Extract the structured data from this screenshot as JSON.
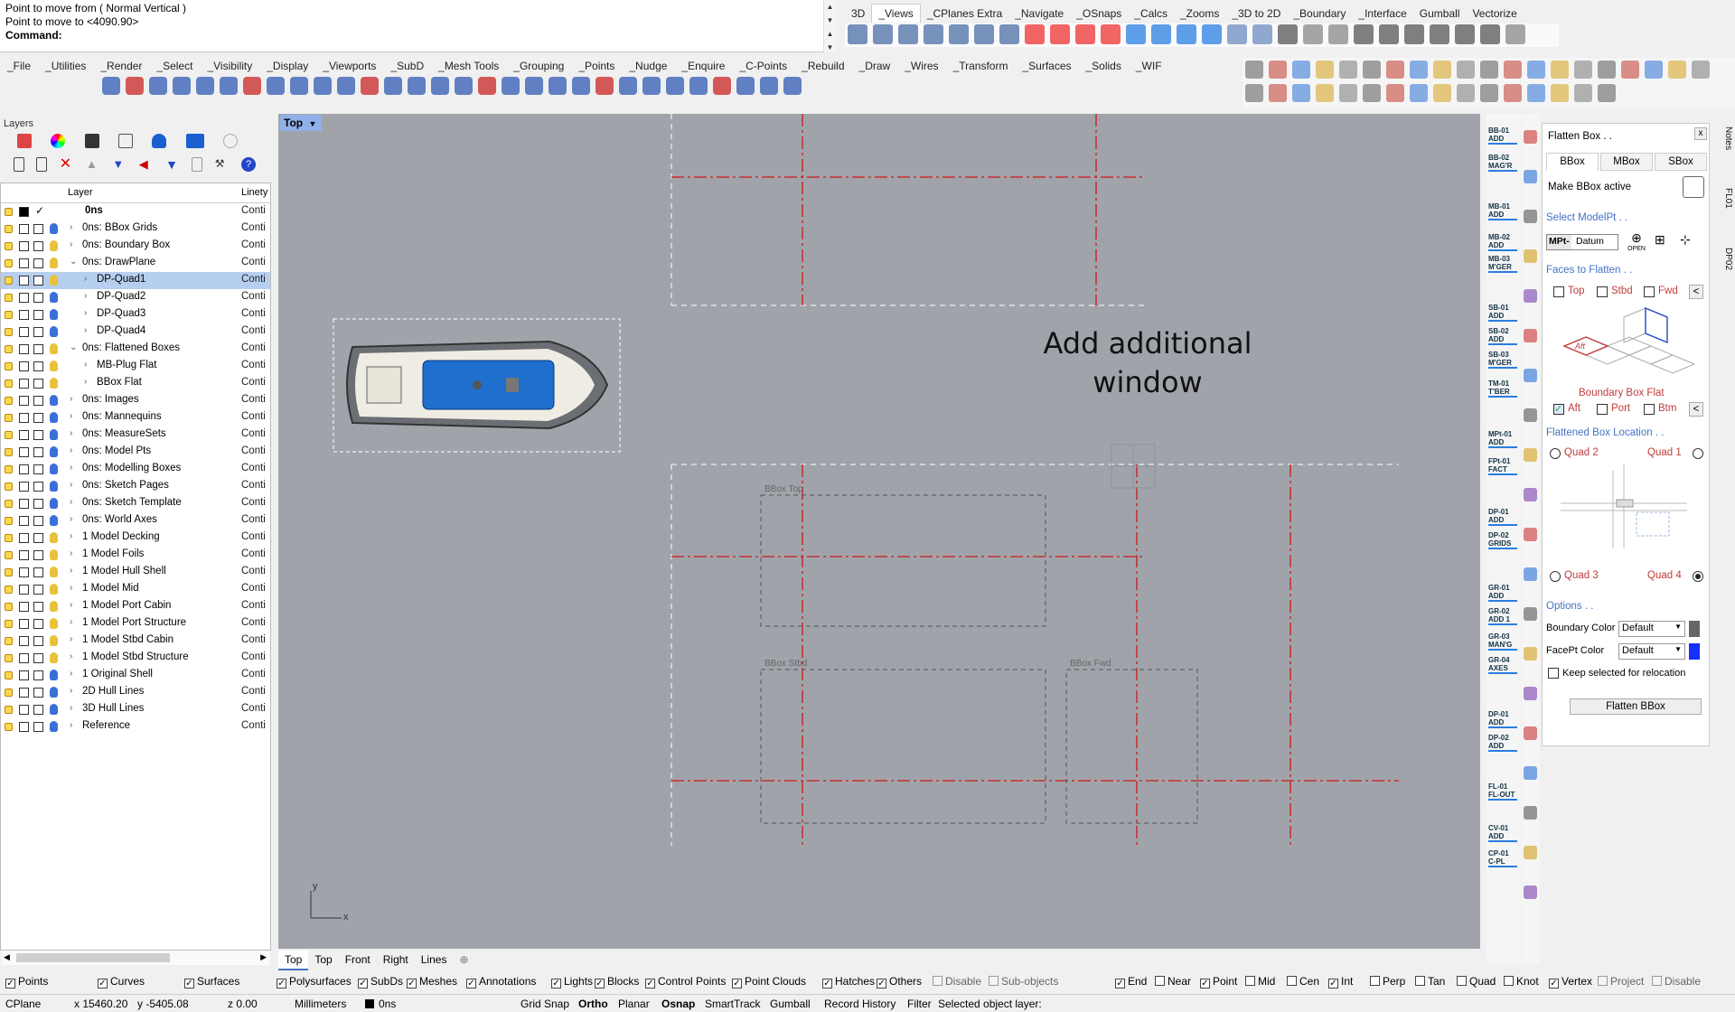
{
  "command": {
    "history_1": "Point to move from ( Normal  Vertical )",
    "history_2": "Point to move to <4090.90>",
    "prompt": "Command:"
  },
  "top_tabs": [
    "3D",
    "_Views",
    "_CPlanes Extra",
    "_Navigate",
    "_OSnaps",
    "_Calcs",
    "_Zooms",
    "_3D to 2D",
    "_Boundary",
    "_Interface",
    "Gumball",
    "Vectorize"
  ],
  "main_tabs": [
    "_File",
    "_Utilities",
    "_Render",
    "_Select",
    "_Visibility",
    "_Display",
    "_Viewports",
    "_SubD",
    "_Mesh Tools",
    "_Grouping",
    "_Points",
    "_Nudge",
    "_Enquire",
    "_C-Points",
    "_Rebuild",
    "_Draw",
    "_Wires",
    "_Transform",
    "_Surfaces",
    "_Solids",
    "_WIF"
  ],
  "layers_panel": {
    "title": "Layers",
    "col_layer": "Layer",
    "col_linetype": "Linety",
    "rows": [
      {
        "name": "0ns",
        "linetype": "Conti",
        "level": 0,
        "expand": "",
        "bold": true,
        "bulb": "",
        "current": true,
        "sel": false
      },
      {
        "name": "0ns: BBox Grids",
        "linetype": "Conti",
        "level": 1,
        "expand": ">",
        "bulb": "#3a6fd8",
        "sel": false
      },
      {
        "name": "0ns: Boundary Box",
        "linetype": "Conti",
        "level": 1,
        "expand": ">",
        "bulb": "#e8c23a",
        "sel": false
      },
      {
        "name": "0ns: DrawPlane",
        "linetype": "Conti",
        "level": 1,
        "expand": "v",
        "bulb": "#e8c23a",
        "sel": false
      },
      {
        "name": "DP-Quad1",
        "linetype": "Conti",
        "level": 2,
        "expand": ">",
        "bulb": "#e8c23a",
        "sel": true
      },
      {
        "name": "DP-Quad2",
        "linetype": "Conti",
        "level": 2,
        "expand": ">",
        "bulb": "#3a6fd8",
        "sel": false
      },
      {
        "name": "DP-Quad3",
        "linetype": "Conti",
        "level": 2,
        "expand": ">",
        "bulb": "#3a6fd8",
        "sel": false
      },
      {
        "name": "DP-Quad4",
        "linetype": "Conti",
        "level": 2,
        "expand": ">",
        "bulb": "#3a6fd8",
        "sel": false
      },
      {
        "name": "0ns: Flattened Boxes",
        "linetype": "Conti",
        "level": 1,
        "expand": "v",
        "bulb": "#e8c23a",
        "sel": false
      },
      {
        "name": "MB-Plug Flat",
        "linetype": "Conti",
        "level": 2,
        "expand": ">",
        "bulb": "#e8c23a",
        "sel": false
      },
      {
        "name": "BBox Flat",
        "linetype": "Conti",
        "level": 2,
        "expand": ">",
        "bulb": "#e8c23a",
        "sel": false
      },
      {
        "name": "0ns: Images",
        "linetype": "Conti",
        "level": 1,
        "expand": ">",
        "bulb": "#3a6fd8",
        "sel": false
      },
      {
        "name": "0ns: Mannequins",
        "linetype": "Conti",
        "level": 1,
        "expand": ">",
        "bulb": "#3a6fd8",
        "sel": false
      },
      {
        "name": "0ns: MeasureSets",
        "linetype": "Conti",
        "level": 1,
        "expand": ">",
        "bulb": "#3a6fd8",
        "sel": false
      },
      {
        "name": "0ns: Model Pts",
        "linetype": "Conti",
        "level": 1,
        "expand": ">",
        "bulb": "#3a6fd8",
        "sel": false
      },
      {
        "name": "0ns: Modelling Boxes",
        "linetype": "Conti",
        "level": 1,
        "expand": ">",
        "bulb": "#3a6fd8",
        "sel": false
      },
      {
        "name": "0ns: Sketch Pages",
        "linetype": "Conti",
        "level": 1,
        "expand": ">",
        "bulb": "#3a6fd8",
        "sel": false
      },
      {
        "name": "0ns: Sketch Template",
        "linetype": "Conti",
        "level": 1,
        "expand": ">",
        "bulb": "#3a6fd8",
        "sel": false
      },
      {
        "name": "0ns: World Axes",
        "linetype": "Conti",
        "level": 1,
        "expand": ">",
        "bulb": "#3a6fd8",
        "sel": false
      },
      {
        "name": "1 Model Decking",
        "linetype": "Conti",
        "level": 1,
        "expand": ">",
        "bulb": "#e8c23a",
        "sel": false
      },
      {
        "name": "1 Model Foils",
        "linetype": "Conti",
        "level": 1,
        "expand": ">",
        "bulb": "#e8c23a",
        "sel": false
      },
      {
        "name": "1 Model Hull Shell",
        "linetype": "Conti",
        "level": 1,
        "expand": ">",
        "bulb": "#e8c23a",
        "sel": false
      },
      {
        "name": "1 Model Mid",
        "linetype": "Conti",
        "level": 1,
        "expand": ">",
        "bulb": "#e8c23a",
        "sel": false
      },
      {
        "name": "1 Model Port Cabin",
        "linetype": "Conti",
        "level": 1,
        "expand": ">",
        "bulb": "#e8c23a",
        "sel": false
      },
      {
        "name": "1 Model Port Structure",
        "linetype": "Conti",
        "level": 1,
        "expand": ">",
        "bulb": "#e8c23a",
        "sel": false
      },
      {
        "name": "1 Model Stbd Cabin",
        "linetype": "Conti",
        "level": 1,
        "expand": ">",
        "bulb": "#e8c23a",
        "sel": false
      },
      {
        "name": "1 Model Stbd Structure",
        "linetype": "Conti",
        "level": 1,
        "expand": ">",
        "bulb": "#e8c23a",
        "sel": false
      },
      {
        "name": "1 Original Shell",
        "linetype": "Conti",
        "level": 1,
        "expand": ">",
        "bulb": "#3a6fd8",
        "sel": false
      },
      {
        "name": "2D Hull Lines",
        "linetype": "Conti",
        "level": 1,
        "expand": ">",
        "bulb": "#3a6fd8",
        "sel": false
      },
      {
        "name": "3D Hull Lines",
        "linetype": "Conti",
        "level": 1,
        "expand": ">",
        "bulb": "#3a6fd8",
        "sel": false
      },
      {
        "name": "Reference",
        "linetype": "Conti",
        "level": 1,
        "expand": ">",
        "bulb": "#3a6fd8",
        "sel": false
      }
    ]
  },
  "viewport": {
    "label": "Top",
    "annotation": [
      "Add additional",
      "window"
    ],
    "bbox_labels": {
      "top": "BBox Top",
      "stbd": "BBox Stbd",
      "fwd": "BBox Fwd"
    },
    "axis_y": "y",
    "axis_x": "x",
    "tabs": [
      "Top",
      "Top",
      "Front",
      "Right",
      "Lines"
    ]
  },
  "sidebar_labels": [
    "BB-01 ADD",
    "BB-02 MAG'R",
    "MB-01 ADD",
    "MB-02 ADD",
    "MB-03 M'GER",
    "SB-01 ADD",
    "SB-02 ADD",
    "SB-03 M'GER",
    "TM-01 T'BER",
    "MPt-01 ADD",
    "FPt-01 FACT",
    "DP-01 ADD",
    "DP-02 GRIDS",
    "GR-01 ADD",
    "GR-02 ADD 1",
    "GR-03 MAN'G",
    "GR-04 AXES",
    "DP-01 ADD",
    "DP-02 ADD",
    "FL-01 FL-OUT",
    "CV-01 ADD",
    "CP-01 C-PL"
  ],
  "vertical_tabs": [
    "Notes",
    "FL01",
    "DP02"
  ],
  "flatten_panel": {
    "title": "Flatten Box . .",
    "close": "x",
    "tabs": [
      "BBox",
      "MBox",
      "SBox"
    ],
    "make_active": "Make BBox active",
    "select_modelpt": "Select ModelPt . .",
    "mpt_label": "MPt-",
    "mpt_value": "Datum",
    "open_label": "OPEN",
    "faces_title": "Faces to Flatten . .",
    "faces": {
      "top": "Top",
      "stbd": "Stbd",
      "fwd": "Fwd",
      "aft": "Aft",
      "port": "Port",
      "btm": "Btm"
    },
    "diagram_label": "Aft",
    "flat_label": "Boundary Box Flat",
    "location_title": "Flattened Box Location . .",
    "quads": {
      "q1": "Quad 1",
      "q2": "Quad 2",
      "q3": "Quad 3",
      "q4": "Quad 4"
    },
    "options_title": "Options . .",
    "boundary_color_label": "Boundary Color",
    "boundary_color_value": "Default",
    "facept_color_label": "FacePt Color",
    "facept_color_value": "Default",
    "keep_selected": "Keep selected for relocation",
    "flatten_button": "Flatten BBox",
    "expand_symbol": "<"
  },
  "filters": [
    {
      "label": "Points",
      "checked": true
    },
    {
      "label": "Curves",
      "checked": true
    },
    {
      "label": "Surfaces",
      "checked": true
    },
    {
      "label": "Polysurfaces",
      "checked": true
    },
    {
      "label": "SubDs",
      "checked": true
    },
    {
      "label": "Meshes",
      "checked": true
    },
    {
      "label": "Annotations",
      "checked": true
    },
    {
      "label": "Lights",
      "checked": true
    },
    {
      "label": "Blocks",
      "checked": true
    },
    {
      "label": "Control Points",
      "checked": true
    },
    {
      "label": "Point Clouds",
      "checked": true
    },
    {
      "label": "Hatches",
      "checked": true
    },
    {
      "label": "Others",
      "checked": true
    },
    {
      "label": "Disable",
      "checked": false,
      "disabled": true
    },
    {
      "label": "Sub-objects",
      "checked": false,
      "disabled": true
    }
  ],
  "osnaps": [
    {
      "label": "End",
      "checked": true
    },
    {
      "label": "Near",
      "checked": false
    },
    {
      "label": "Point",
      "checked": true
    },
    {
      "label": "Mid",
      "checked": false
    },
    {
      "label": "Cen",
      "checked": false
    },
    {
      "label": "Int",
      "checked": true
    },
    {
      "label": "Perp",
      "checked": false
    },
    {
      "label": "Tan",
      "checked": false
    },
    {
      "label": "Quad",
      "checked": false
    },
    {
      "label": "Knot",
      "checked": false
    },
    {
      "label": "Vertex",
      "checked": true
    },
    {
      "label": "Project",
      "checked": false,
      "disabled": true
    },
    {
      "label": "Disable",
      "checked": false,
      "disabled": true
    }
  ],
  "status": {
    "cplane": "CPlane",
    "x": "x 15460.20",
    "y": "y -5405.08",
    "z": "z 0.00",
    "units": "Millimeters",
    "layer": "0ns",
    "grid_snap": "Grid Snap",
    "ortho": "Ortho",
    "planar": "Planar",
    "osnap": "Osnap",
    "smarttrack": "SmartTrack",
    "gumball": "Gumball",
    "record_history": "Record History",
    "filter": "Filter",
    "message": "Selected object layer:"
  },
  "colors": {
    "viewport_bg": "#a0a4aa",
    "grid_red": "#d01818",
    "selected_row": "#b6cff0",
    "accent_blue": "#4472c4"
  }
}
